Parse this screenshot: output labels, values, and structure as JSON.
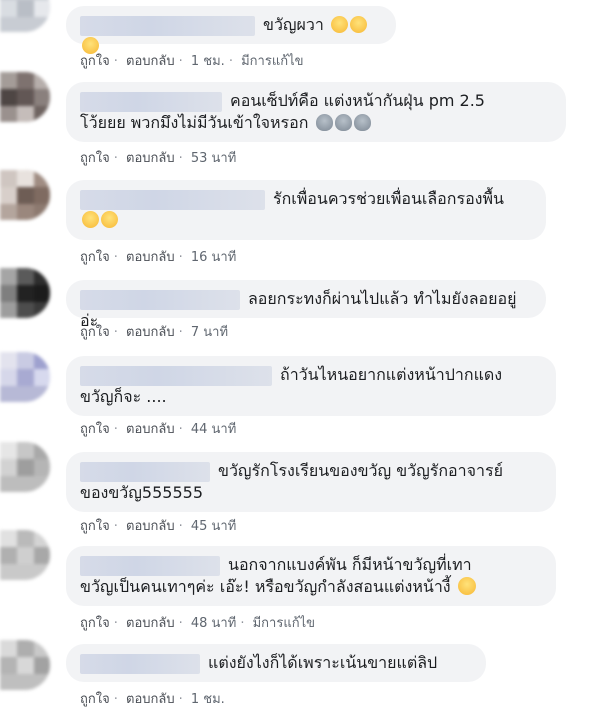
{
  "comments": [
    {
      "text": "ขวัญผวา",
      "emoji": [
        "smile",
        "smile",
        "smile"
      ],
      "like": "ถูกใจ",
      "reply": "ตอบกลับ",
      "time": "1 ชม.",
      "edited": "มีการแก้ไข"
    },
    {
      "text": "คอนเซ็ปท์คือ แต่งหน้ากันฝุ่น pm 2.5\nโว้ยยย พวกมึงไม่มีวันเข้าใจหรอก",
      "emoji": [
        "alien",
        "alien",
        "alien"
      ],
      "like": "ถูกใจ",
      "reply": "ตอบกลับ",
      "time": "53 นาที"
    },
    {
      "text": "รักเพื่อนควรช่วยเพื่อนเลือกรองพื้น",
      "emoji": [
        "tongue",
        "tongue"
      ],
      "like": "ถูกใจ",
      "reply": "ตอบกลับ",
      "time": "16 นาที"
    },
    {
      "text": "ลอยกระทงก็ผ่านไปแล้ว ทำไมยังลอยอยู่อ่ะ",
      "emoji": [],
      "like": "ถูกใจ",
      "reply": "ตอบกลับ",
      "time": "7 นาที"
    },
    {
      "text": "ถ้าวันไหนอยากแต่งหน้าปากแดง\nขวัญก็จะ ....",
      "emoji": [],
      "like": "ถูกใจ",
      "reply": "ตอบกลับ",
      "time": "44 นาที"
    },
    {
      "text": "ขวัญรักโรงเรียนของขวัญ ขวัญรักอาจารย์\nของขวัญ555555",
      "emoji": [],
      "like": "ถูกใจ",
      "reply": "ตอบกลับ",
      "time": "45 นาที"
    },
    {
      "text": "นอกจากแบงค์พัน ก็มีหน้าขวัญที่เทา\nขวัญเป็นคนเทาๆค่ะ เอ๊ะ! หรือขวัญกำลังสอนแต่งหน้างี้",
      "emoji": [
        "worried"
      ],
      "like": "ถูกใจ",
      "reply": "ตอบกลับ",
      "time": "48 นาที",
      "edited": "มีการแก้ไข"
    },
    {
      "text": "แต่งยังไงก็ได้เพราะเน้นขายแต่ลิป",
      "emoji": [],
      "like": "ถูกใจ",
      "reply": "ตอบกลับ",
      "time": "1 ชม."
    }
  ]
}
